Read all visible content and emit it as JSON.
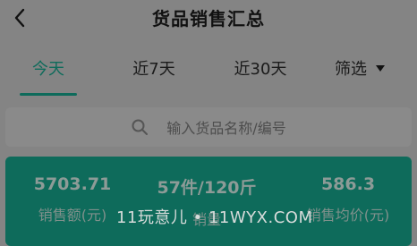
{
  "header": {
    "title": "货品销售汇总",
    "back_icon": "chevron-left-icon"
  },
  "tabs": [
    {
      "label": "今天",
      "active": true
    },
    {
      "label": "近7天",
      "active": false
    },
    {
      "label": "近30天",
      "active": false
    }
  ],
  "filter": {
    "label": "筛选",
    "icon": "caret-down-icon"
  },
  "search": {
    "placeholder": "输入货品名称/编号",
    "icon": "search-icon"
  },
  "summary": {
    "sales_amount": {
      "value": "5703.71",
      "label": "销售额(元)"
    },
    "sales_volume": {
      "value": "57件/120斤",
      "label": "销量"
    },
    "avg_price": {
      "value": "586.3",
      "label": "销售均价(元)"
    }
  },
  "watermark": {
    "text": "11玩意儿 • 11WYX.COM"
  },
  "colors": {
    "accent": "#0e6b5b",
    "overlay_background": "#848484"
  }
}
